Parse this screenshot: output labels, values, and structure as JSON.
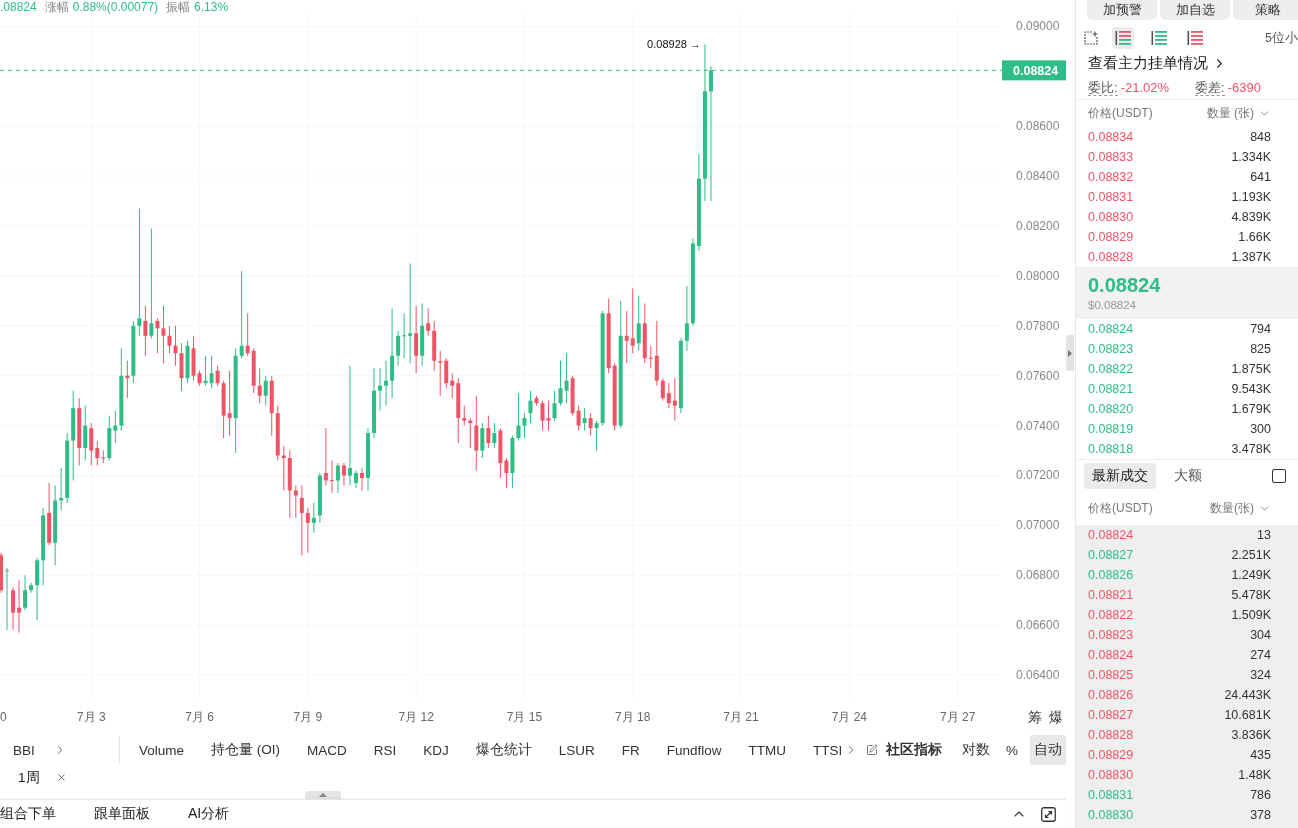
{
  "chart_header": {
    "stats": [
      {
        "value": ".08824"
      },
      {
        "label": "涨幅",
        "value": "0.88%(0.00077)"
      },
      {
        "label": "振幅",
        "value": "6.13%"
      }
    ]
  },
  "chart": {
    "axis_buttons": [
      "筹",
      "爆"
    ],
    "edge_axis_label": "0",
    "chart_data": [
      {
        "type": "candlestick",
        "grid": true,
        "xlim": [
          "--06-30T11:20",
          "--07-28T04:10"
        ],
        "ylim": [
          0.063,
          0.0905
        ],
        "xticks": [
          {
            "value": "--07-03",
            "label": "7月 3"
          },
          {
            "value": "--07-06",
            "label": "7月 6"
          },
          {
            "value": "--07-09",
            "label": "7月 9"
          },
          {
            "value": "--07-12",
            "label": "7月 12"
          },
          {
            "value": "--07-15",
            "label": "7月 15"
          },
          {
            "value": "--07-18",
            "label": "7月 18"
          },
          {
            "value": "--07-21",
            "label": "7月 21"
          },
          {
            "value": "--07-24",
            "label": "7月 24"
          },
          {
            "value": "--07-27",
            "label": "7月 27"
          }
        ],
        "yticks": [
          {
            "value": 0.064,
            "label": "0.06400"
          },
          {
            "value": 0.066,
            "label": "0.06600"
          },
          {
            "value": 0.068,
            "label": "0.06800"
          },
          {
            "value": 0.07,
            "label": "0.07000"
          },
          {
            "value": 0.072,
            "label": "0.07200"
          },
          {
            "value": 0.074,
            "label": "0.07400"
          },
          {
            "value": 0.076,
            "label": "0.07600"
          },
          {
            "value": 0.078,
            "label": "0.07800"
          },
          {
            "value": 0.08,
            "label": "0.08000"
          },
          {
            "value": 0.082,
            "label": "0.08200"
          },
          {
            "value": 0.084,
            "label": "0.08400"
          },
          {
            "value": 0.086,
            "label": "0.08600"
          },
          {
            "value": 0.09,
            "label": "0.09000"
          }
        ],
        "ref_lines": [
          {
            "axis": "y",
            "value": 0.08824,
            "label": "0.08824",
            "color": "#2ebd85",
            "line_style": "dashed"
          }
        ],
        "annotations": [
          "0.08928 →"
        ],
        "x": [
          "--06-30T12:00",
          "--06-30T16:00",
          "--06-30T20:00",
          "--07-01T00:00",
          "--07-01T04:00",
          "--07-01T08:00",
          "--07-01T12:00",
          "--07-01T16:00",
          "--07-01T20:00",
          "--07-02T00:00",
          "--07-02T04:00",
          "--07-02T08:00",
          "--07-02T12:00",
          "--07-02T16:00",
          "--07-02T20:00",
          "--07-03T00:00",
          "--07-03T04:00",
          "--07-03T08:00",
          "--07-03T12:00",
          "--07-03T16:00",
          "--07-03T20:00",
          "--07-04T00:00",
          "--07-04T04:00",
          "--07-04T08:00",
          "--07-04T12:00",
          "--07-04T16:00",
          "--07-04T20:00",
          "--07-05T00:00",
          "--07-05T04:00",
          "--07-05T08:00",
          "--07-05T12:00",
          "--07-05T16:00",
          "--07-05T20:00",
          "--07-06T00:00",
          "--07-06T04:00",
          "--07-06T08:00",
          "--07-06T12:00",
          "--07-06T16:00",
          "--07-06T20:00",
          "--07-07T00:00",
          "--07-07T04:00",
          "--07-07T08:00",
          "--07-07T12:00",
          "--07-07T16:00",
          "--07-07T20:00",
          "--07-08T00:00",
          "--07-08T04:00",
          "--07-08T08:00",
          "--07-08T12:00",
          "--07-08T16:00",
          "--07-08T20:00",
          "--07-09T00:00",
          "--07-09T04:00",
          "--07-09T08:00",
          "--07-09T12:00",
          "--07-09T16:00",
          "--07-09T20:00",
          "--07-10T00:00",
          "--07-10T04:00",
          "--07-10T08:00",
          "--07-10T12:00",
          "--07-10T16:00",
          "--07-10T20:00",
          "--07-11T00:00",
          "--07-11T04:00",
          "--07-11T08:00",
          "--07-11T12:00",
          "--07-11T16:00",
          "--07-11T20:00",
          "--07-12T00:00",
          "--07-12T04:00",
          "--07-12T08:00",
          "--07-12T12:00",
          "--07-12T16:00",
          "--07-12T20:00",
          "--07-13T00:00",
          "--07-13T04:00",
          "--07-13T08:00",
          "--07-13T12:00",
          "--07-13T16:00",
          "--07-13T20:00",
          "--07-14T00:00",
          "--07-14T04:00",
          "--07-14T08:00",
          "--07-14T12:00",
          "--07-14T16:00",
          "--07-14T20:00",
          "--07-15T00:00",
          "--07-15T04:00",
          "--07-15T08:00",
          "--07-15T12:00",
          "--07-15T16:00",
          "--07-15T20:00",
          "--07-16T00:00",
          "--07-16T04:00",
          "--07-16T08:00",
          "--07-16T12:00",
          "--07-16T16:00",
          "--07-16T20:00",
          "--07-17T00:00",
          "--07-17T04:00",
          "--07-17T08:00",
          "--07-17T12:00",
          "--07-17T16:00",
          "--07-17T20:00",
          "--07-18T00:00",
          "--07-18T04:00",
          "--07-18T08:00",
          "--07-18T12:00",
          "--07-18T16:00",
          "--07-18T20:00",
          "--07-19T00:00",
          "--07-19T04:00",
          "--07-19T08:00",
          "--07-19T12:00",
          "--07-19T16:00",
          "--07-19T20:00",
          "--07-20T00:00",
          "--07-20T04:00"
        ],
        "ohlc": [
          [
            0.0688,
            0.0689,
            0.0673,
            0.0674
          ],
          [
            0.0682,
            0.0683,
            0.0658,
            0.0682
          ],
          [
            0.0674,
            0.0675,
            0.0658,
            0.0665
          ],
          [
            0.0667,
            0.0678,
            0.0657,
            0.0665
          ],
          [
            0.0667,
            0.068,
            0.0666,
            0.0674
          ],
          [
            0.0674,
            0.0677,
            0.0673,
            0.0676
          ],
          [
            0.0676,
            0.0687,
            0.0662,
            0.0686
          ],
          [
            0.0686,
            0.0707,
            0.0676,
            0.0704
          ],
          [
            0.0705,
            0.0717,
            0.0692,
            0.0693
          ],
          [
            0.0693,
            0.0716,
            0.0684,
            0.071
          ],
          [
            0.071,
            0.0723,
            0.0706,
            0.0711
          ],
          [
            0.0711,
            0.0737,
            0.0709,
            0.0734
          ],
          [
            0.0734,
            0.0754,
            0.0718,
            0.0747
          ],
          [
            0.0747,
            0.0751,
            0.0724,
            0.0731
          ],
          [
            0.0731,
            0.0748,
            0.0726,
            0.074
          ],
          [
            0.0739,
            0.0741,
            0.0724,
            0.073
          ],
          [
            0.0731,
            0.0734,
            0.0724,
            0.0727
          ],
          [
            0.07272,
            0.073,
            0.0725,
            0.07268
          ],
          [
            0.0727,
            0.0744,
            0.0726,
            0.0739
          ],
          [
            0.0738,
            0.0746,
            0.0733,
            0.074
          ],
          [
            0.074,
            0.0771,
            0.0738,
            0.076
          ],
          [
            0.076,
            0.0766,
            0.0751,
            0.0759
          ],
          [
            0.076,
            0.0782,
            0.0757,
            0.078
          ],
          [
            0.078,
            0.0827,
            0.0776,
            0.0783
          ],
          [
            0.0782,
            0.0788,
            0.0768,
            0.0776
          ],
          [
            0.0776,
            0.0819,
            0.0775,
            0.0781
          ],
          [
            0.0782,
            0.0783,
            0.0769,
            0.0779
          ],
          [
            0.0779,
            0.0788,
            0.0765,
            0.0776
          ],
          [
            0.0776,
            0.078,
            0.0769,
            0.0772
          ],
          [
            0.0772,
            0.078,
            0.0764,
            0.0769
          ],
          [
            0.0769,
            0.0773,
            0.0754,
            0.0759
          ],
          [
            0.0759,
            0.0774,
            0.0757,
            0.0772
          ],
          [
            0.0771,
            0.0776,
            0.0758,
            0.076
          ],
          [
            0.0761,
            0.0762,
            0.0756,
            0.0757
          ],
          [
            0.0757,
            0.0768,
            0.0756,
            0.0758
          ],
          [
            0.0757,
            0.0768,
            0.0755,
            0.0761
          ],
          [
            0.0762,
            0.0764,
            0.0756,
            0.0757
          ],
          [
            0.0757,
            0.0758,
            0.0735,
            0.0744
          ],
          [
            0.0745,
            0.0762,
            0.0736,
            0.0743
          ],
          [
            0.0743,
            0.0771,
            0.0729,
            0.0768
          ],
          [
            0.0768,
            0.0802,
            0.0767,
            0.0772
          ],
          [
            0.0772,
            0.0785,
            0.0768,
            0.0769
          ],
          [
            0.077,
            0.0771,
            0.0753,
            0.0756
          ],
          [
            0.0756,
            0.0763,
            0.0749,
            0.0752
          ],
          [
            0.0752,
            0.076,
            0.0748,
            0.0758
          ],
          [
            0.0758,
            0.076,
            0.0736,
            0.0745
          ],
          [
            0.0745,
            0.0748,
            0.0726,
            0.0728
          ],
          [
            0.0728,
            0.0732,
            0.0714,
            0.0727
          ],
          [
            0.0727,
            0.073,
            0.0703,
            0.0714
          ],
          [
            0.0714,
            0.0716,
            0.0703,
            0.0712
          ],
          [
            0.0711,
            0.0716,
            0.0688,
            0.0705
          ],
          [
            0.0705,
            0.0707,
            0.0689,
            0.0701
          ],
          [
            0.0701,
            0.0709,
            0.0697,
            0.0703
          ],
          [
            0.0704,
            0.0721,
            0.0701,
            0.072
          ],
          [
            0.0721,
            0.0739,
            0.0716,
            0.0718
          ],
          [
            0.07182,
            0.0726,
            0.0713,
            0.07178
          ],
          [
            0.0718,
            0.0725,
            0.0713,
            0.0724
          ],
          [
            0.0724,
            0.0725,
            0.0716,
            0.072
          ],
          [
            0.072,
            0.0764,
            0.0716,
            0.0723
          ],
          [
            0.0717,
            0.0722,
            0.0715,
            0.0721
          ],
          [
            0.0721,
            0.0723,
            0.0714,
            0.0719
          ],
          [
            0.0719,
            0.0739,
            0.0714,
            0.0737
          ],
          [
            0.0737,
            0.0763,
            0.0735,
            0.0754
          ],
          [
            0.0754,
            0.0763,
            0.0746,
            0.0756
          ],
          [
            0.0756,
            0.0766,
            0.0748,
            0.0758
          ],
          [
            0.0758,
            0.0787,
            0.0751,
            0.0768
          ],
          [
            0.0768,
            0.0778,
            0.0764,
            0.0776
          ],
          [
            0.07758,
            0.0785,
            0.0767,
            0.07762
          ],
          [
            0.0776,
            0.0805,
            0.0765,
            0.0777
          ],
          [
            0.0777,
            0.0788,
            0.0761,
            0.0768
          ],
          [
            0.0768,
            0.0789,
            0.0764,
            0.078
          ],
          [
            0.0781,
            0.0787,
            0.0776,
            0.0778
          ],
          [
            0.0778,
            0.0782,
            0.0762,
            0.0766
          ],
          [
            0.07658,
            0.077,
            0.0752,
            0.07652
          ],
          [
            0.0766,
            0.0767,
            0.0755,
            0.0757
          ],
          [
            0.0758,
            0.0761,
            0.0751,
            0.0756
          ],
          [
            0.0757,
            0.0759,
            0.0733,
            0.0743
          ],
          [
            0.0743,
            0.0748,
            0.074,
            0.0742
          ],
          [
            0.0742,
            0.0743,
            0.0731,
            0.0741
          ],
          [
            0.074,
            0.0752,
            0.0722,
            0.073
          ],
          [
            0.073,
            0.0741,
            0.0727,
            0.0739
          ],
          [
            0.0739,
            0.0744,
            0.0731,
            0.0733
          ],
          [
            0.0733,
            0.0741,
            0.0731,
            0.0737
          ],
          [
            0.0738,
            0.0739,
            0.0719,
            0.0725
          ],
          [
            0.0726,
            0.0727,
            0.0715,
            0.0721
          ],
          [
            0.0721,
            0.0736,
            0.0715,
            0.0735
          ],
          [
            0.0735,
            0.0753,
            0.0734,
            0.074
          ],
          [
            0.074,
            0.0745,
            0.0735,
            0.0743
          ],
          [
            0.0745,
            0.0754,
            0.0741,
            0.075
          ],
          [
            0.0751,
            0.0752,
            0.0748,
            0.0749
          ],
          [
            0.0749,
            0.075,
            0.0738,
            0.0742
          ],
          [
            0.0743,
            0.075,
            0.0738,
            0.0742
          ],
          [
            0.0743,
            0.0754,
            0.0742,
            0.0749
          ],
          [
            0.0749,
            0.0766,
            0.0748,
            0.0755
          ],
          [
            0.0754,
            0.0769,
            0.0749,
            0.0758
          ],
          [
            0.0759,
            0.076,
            0.0744,
            0.0745
          ],
          [
            0.0746,
            0.0748,
            0.0738,
            0.074
          ],
          [
            0.0741,
            0.0747,
            0.0738,
            0.0743
          ],
          [
            0.0743,
            0.0745,
            0.0736,
            0.0739
          ],
          [
            0.0739,
            0.0742,
            0.073,
            0.0741
          ],
          [
            0.0741,
            0.0786,
            0.074,
            0.0785
          ],
          [
            0.0785,
            0.0791,
            0.0761,
            0.0763
          ],
          [
            0.0764,
            0.0765,
            0.0738,
            0.074
          ],
          [
            0.074,
            0.079,
            0.0739,
            0.0776
          ],
          [
            0.0776,
            0.0786,
            0.0765,
            0.0774
          ],
          [
            0.0775,
            0.0795,
            0.0769,
            0.0772
          ],
          [
            0.0773,
            0.0792,
            0.077,
            0.0781
          ],
          [
            0.0781,
            0.0789,
            0.0765,
            0.0767
          ],
          [
            0.07672,
            0.0772,
            0.0763,
            0.07668
          ],
          [
            0.0768,
            0.0782,
            0.0756,
            0.0758
          ],
          [
            0.0758,
            0.0759,
            0.075,
            0.0751
          ],
          [
            0.0753,
            0.0757,
            0.0747,
            0.0749
          ],
          [
            0.075,
            0.0759,
            0.0742,
            0.0748
          ],
          [
            0.0747,
            0.0775,
            0.0745,
            0.0774
          ],
          [
            0.0774,
            0.0796,
            0.077,
            0.0781
          ],
          [
            0.0781,
            0.0815,
            0.078,
            0.0813
          ],
          [
            0.0812,
            0.0849,
            0.081,
            0.0839
          ],
          [
            0.0839,
            0.08928,
            0.083,
            0.0874
          ],
          [
            0.0874,
            0.0884,
            0.083,
            0.08824
          ]
        ]
      }
    ]
  },
  "indicator_bar": {
    "overlay": "BBI",
    "indicators": [
      "Volume",
      "持仓量 (OI)",
      "MACD",
      "RSI",
      "KDJ",
      "爆仓统计",
      "LSUR",
      "FR",
      "Fundflow",
      "TTMU",
      "TTSI"
    ],
    "community": "社区指标",
    "scale_options": [
      {
        "label": "对数",
        "selected": false
      },
      {
        "label": "%",
        "selected": false
      },
      {
        "label": "自动",
        "selected": true
      }
    ]
  },
  "interval_tag": {
    "label": "1周"
  },
  "bottom_tabs": [
    "组合下单",
    "跟单面板",
    "AI分析"
  ],
  "panel_actions": [
    "加预警",
    "加自选",
    "策略"
  ],
  "book_toolbar": {
    "views": [
      {
        "kind": "both",
        "selected": true
      },
      {
        "kind": "bids",
        "selected": false
      },
      {
        "kind": "asks",
        "selected": false
      }
    ],
    "precision": "5位小"
  },
  "whale_link": "查看主力挂单情况",
  "book_stats": [
    {
      "label": "委比:",
      "value": "-21.02%"
    },
    {
      "label": "委差:",
      "value": "-6390"
    }
  ],
  "order_book": {
    "columns": [
      "价格(USDT)",
      "数量 (张)"
    ],
    "asks": [
      {
        "price": "0.08834",
        "amount": "848"
      },
      {
        "price": "0.08833",
        "amount": "1.334K"
      },
      {
        "price": "0.08832",
        "amount": "641"
      },
      {
        "price": "0.08831",
        "amount": "1.193K"
      },
      {
        "price": "0.08830",
        "amount": "4.839K"
      },
      {
        "price": "0.08829",
        "amount": "1.66K"
      },
      {
        "price": "0.08828",
        "amount": "1.387K"
      }
    ],
    "last_price": "0.08824",
    "last_price_usd": "$0.08824",
    "bids": [
      {
        "price": "0.08824",
        "amount": "794"
      },
      {
        "price": "0.08823",
        "amount": "825"
      },
      {
        "price": "0.08822",
        "amount": "1.875K"
      },
      {
        "price": "0.08821",
        "amount": "9.543K"
      },
      {
        "price": "0.08820",
        "amount": "1.679K"
      },
      {
        "price": "0.08819",
        "amount": "300"
      },
      {
        "price": "0.08818",
        "amount": "3.478K"
      }
    ]
  },
  "trades": {
    "tabs": [
      {
        "label": "最新成交",
        "selected": true
      },
      {
        "label": "大额",
        "selected": false
      }
    ],
    "large_only": {
      "checked": false
    },
    "columns": [
      "价格(USDT)",
      "数量(张)"
    ],
    "rows": [
      {
        "price": "0.08824",
        "amount": "13",
        "color": "#ef5466"
      },
      {
        "price": "0.08827",
        "amount": "2.251K",
        "color": "#2ebd85"
      },
      {
        "price": "0.08826",
        "amount": "1.249K",
        "color": "#2ebd85"
      },
      {
        "price": "0.08821",
        "amount": "5.478K",
        "color": "#ef5466"
      },
      {
        "price": "0.08822",
        "amount": "1.509K",
        "color": "#ef5466"
      },
      {
        "price": "0.08823",
        "amount": "304",
        "color": "#ef5466"
      },
      {
        "price": "0.08824",
        "amount": "274",
        "color": "#ef5466"
      },
      {
        "price": "0.08825",
        "amount": "324",
        "color": "#ef5466"
      },
      {
        "price": "0.08826",
        "amount": "24.443K",
        "color": "#ef5466"
      },
      {
        "price": "0.08827",
        "amount": "10.681K",
        "color": "#ef5466"
      },
      {
        "price": "0.08828",
        "amount": "3.836K",
        "color": "#ef5466"
      },
      {
        "price": "0.08829",
        "amount": "435",
        "color": "#ef5466"
      },
      {
        "price": "0.08830",
        "amount": "1.48K",
        "color": "#ef5466"
      },
      {
        "price": "0.08831",
        "amount": "786",
        "color": "#2ebd85"
      },
      {
        "price": "0.08830",
        "amount": "378",
        "color": "#2ebd85"
      }
    ]
  }
}
